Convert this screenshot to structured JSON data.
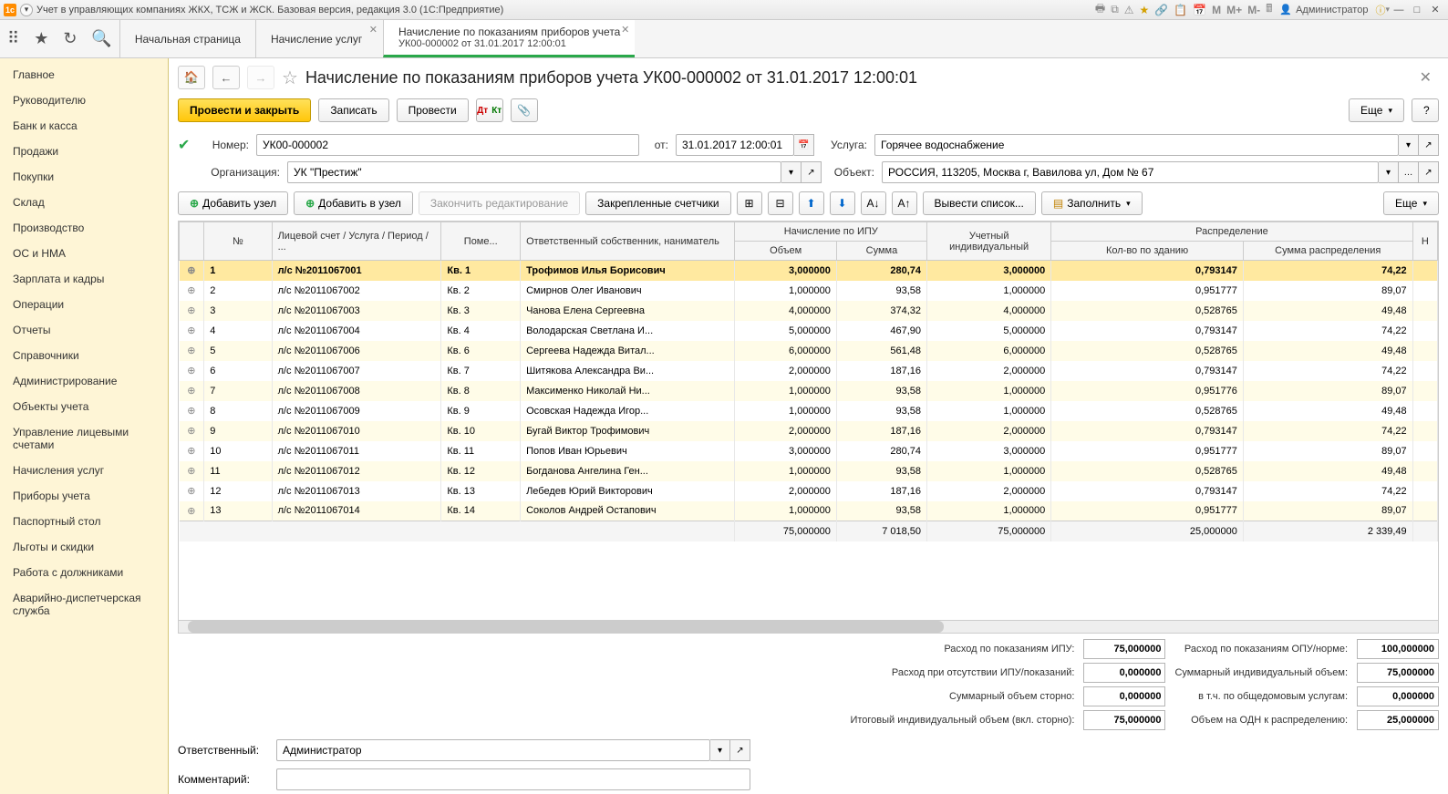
{
  "titlebar": {
    "app_name": "1С:",
    "title": "Учет в управляющих компаниях ЖКХ, ТСЖ и ЖСК. Базовая версия, редакция 3.0  (1С:Предприятие)",
    "m_buttons": [
      "M",
      "M+",
      "M-"
    ],
    "user_label": "Администратор"
  },
  "tabs": [
    {
      "label": "Начальная страница"
    },
    {
      "label": "Начисление услуг"
    },
    {
      "label": "Начисление по показаниям приборов учета",
      "sub": "УК00-000002 от 31.01.2017 12:00:01",
      "active": true
    }
  ],
  "sidebar": {
    "items": [
      "Главное",
      "Руководителю",
      "Банк и касса",
      "Продажи",
      "Покупки",
      "Склад",
      "Производство",
      "ОС и НМА",
      "Зарплата и кадры",
      "Операции",
      "Отчеты",
      "Справочники",
      "Администрирование",
      "Объекты учета",
      "Управление лицевыми счетами",
      "Начисления услуг",
      "Приборы учета",
      "Паспортный стол",
      "Льготы и скидки",
      "Работа с должниками",
      "Аварийно-диспетчерская служба"
    ]
  },
  "doc": {
    "title": "Начисление по показаниям приборов учета УК00-000002 от 31.01.2017 12:00:01",
    "actions": {
      "post_close": "Провести и закрыть",
      "save": "Записать",
      "post": "Провести",
      "more": "Еще"
    },
    "number_label": "Номер:",
    "number": "УК00-000002",
    "date_label": "от:",
    "date": "31.01.2017 12:00:01",
    "service_label": "Услуга:",
    "service": "Горячее водоснабжение",
    "org_label": "Организация:",
    "org": "УК \"Престиж\"",
    "object_label": "Объект:",
    "object": "РОССИЯ, 113205, Москва г, Вавилова ул, Дом № 67",
    "resp_label": "Ответственный:",
    "resp": "Администратор",
    "comment_label": "Комментарий:",
    "comment": ""
  },
  "table_toolbar": {
    "add_node": "Добавить узел",
    "add_in_node": "Добавить в узел",
    "finish_edit": "Закончить редактирование",
    "pinned_meters": "Закрепленные счетчики",
    "output_list": "Вывести список...",
    "fill": "Заполнить",
    "more": "Еще"
  },
  "columns": {
    "no": "№",
    "account": "Лицевой счет / Услуга / Период / ...",
    "room": "Поме...",
    "owner": "Ответственный собственник, наниматель",
    "ipu_group": "Начисление по ИПУ",
    "ipu_vol": "Объем",
    "ipu_sum": "Сумма",
    "ind": "Учетный индивидуальный",
    "dist_group": "Распределение",
    "dist_qty": "Кол-во по зданию",
    "dist_sum": "Сумма распределения",
    "n": "Н"
  },
  "rows": [
    {
      "n": 1,
      "acc": "л/с №2011067001",
      "room": "Кв. 1",
      "owner": "Трофимов Илья Борисович",
      "vol": "3,000000",
      "sum": "280,74",
      "ind": "3,000000",
      "dq": "0,793147",
      "ds": "74,22",
      "sel": true
    },
    {
      "n": 2,
      "acc": "л/с №2011067002",
      "room": "Кв. 2",
      "owner": "Смирнов Олег Иванович",
      "vol": "1,000000",
      "sum": "93,58",
      "ind": "1,000000",
      "dq": "0,951777",
      "ds": "89,07"
    },
    {
      "n": 3,
      "acc": "л/с №2011067003",
      "room": "Кв. 3",
      "owner": "Чанова Елена Сергеевна",
      "vol": "4,000000",
      "sum": "374,32",
      "ind": "4,000000",
      "dq": "0,528765",
      "ds": "49,48"
    },
    {
      "n": 4,
      "acc": "л/с №2011067004",
      "room": "Кв. 4",
      "owner": "Володарская Светлана И...",
      "vol": "5,000000",
      "sum": "467,90",
      "ind": "5,000000",
      "dq": "0,793147",
      "ds": "74,22"
    },
    {
      "n": 5,
      "acc": "л/с №2011067006",
      "room": "Кв. 6",
      "owner": "Сергеева Надежда Витал...",
      "vol": "6,000000",
      "sum": "561,48",
      "ind": "6,000000",
      "dq": "0,528765",
      "ds": "49,48"
    },
    {
      "n": 6,
      "acc": "л/с №2011067007",
      "room": "Кв. 7",
      "owner": "Шитякова Александра Ви...",
      "vol": "2,000000",
      "sum": "187,16",
      "ind": "2,000000",
      "dq": "0,793147",
      "ds": "74,22"
    },
    {
      "n": 7,
      "acc": "л/с №2011067008",
      "room": "Кв. 8",
      "owner": "Максименко Николай Ни...",
      "vol": "1,000000",
      "sum": "93,58",
      "ind": "1,000000",
      "dq": "0,951776",
      "ds": "89,07"
    },
    {
      "n": 8,
      "acc": "л/с №2011067009",
      "room": "Кв. 9",
      "owner": "Осовская Надежда Игор...",
      "vol": "1,000000",
      "sum": "93,58",
      "ind": "1,000000",
      "dq": "0,528765",
      "ds": "49,48"
    },
    {
      "n": 9,
      "acc": "л/с №2011067010",
      "room": "Кв. 10",
      "owner": "Бугай Виктор Трофимович",
      "vol": "2,000000",
      "sum": "187,16",
      "ind": "2,000000",
      "dq": "0,793147",
      "ds": "74,22"
    },
    {
      "n": 10,
      "acc": "л/с №2011067011",
      "room": "Кв. 11",
      "owner": "Попов Иван Юрьевич",
      "vol": "3,000000",
      "sum": "280,74",
      "ind": "3,000000",
      "dq": "0,951777",
      "ds": "89,07"
    },
    {
      "n": 11,
      "acc": "л/с №2011067012",
      "room": "Кв. 12",
      "owner": "Богданова Ангелина Ген...",
      "vol": "1,000000",
      "sum": "93,58",
      "ind": "1,000000",
      "dq": "0,528765",
      "ds": "49,48"
    },
    {
      "n": 12,
      "acc": "л/с №2011067013",
      "room": "Кв. 13",
      "owner": "Лебедев Юрий Викторович",
      "vol": "2,000000",
      "sum": "187,16",
      "ind": "2,000000",
      "dq": "0,793147",
      "ds": "74,22"
    },
    {
      "n": 13,
      "acc": "л/с №2011067014",
      "room": "Кв. 14",
      "owner": "Соколов Андрей Остапович",
      "vol": "1,000000",
      "sum": "93,58",
      "ind": "1,000000",
      "dq": "0,951777",
      "ds": "89,07"
    }
  ],
  "totals": {
    "vol": "75,000000",
    "sum": "7 018,50",
    "ind": "75,000000",
    "dq": "25,000000",
    "ds": "2 339,49"
  },
  "summary": {
    "r1l": "Расход по показаниям ИПУ:",
    "r1v": "75,000000",
    "r1l2": "Расход по показаниям ОПУ/норме:",
    "r1v2": "100,000000",
    "r2l": "Расход при отсутствии ИПУ/показаний:",
    "r2v": "0,000000",
    "r2l2": "Суммарный индивидуальный объем:",
    "r2v2": "75,000000",
    "r3l": "Суммарный объем сторно:",
    "r3v": "0,000000",
    "r3l2": "в т.ч. по общедомовым услугам:",
    "r3v2": "0,000000",
    "r4l": "Итоговый индивидуальный объем (вкл. сторно):",
    "r4v": "75,000000",
    "r4l2": "Объем на ОДН к распределению:",
    "r4v2": "25,000000"
  }
}
